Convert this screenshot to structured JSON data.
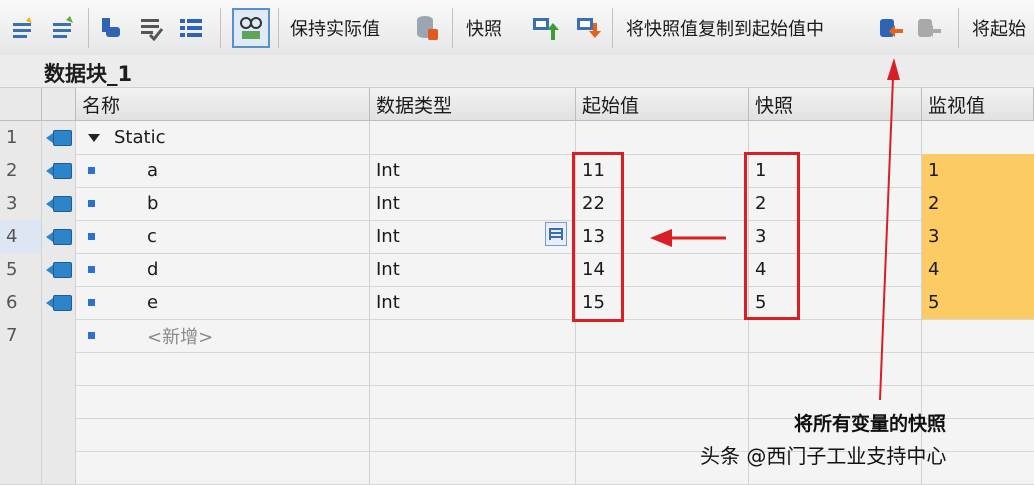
{
  "toolbar": {
    "keep_actual": "保持实际值",
    "snapshot": "快照",
    "copy_snapshot": "将快照值复制到起始值中",
    "load_start": "将起始"
  },
  "block": {
    "title": "数据块_1"
  },
  "columns": {
    "name": "名称",
    "type": "数据类型",
    "start": "起始值",
    "snapshot": "快照",
    "monitor": "监视值"
  },
  "rows": [
    {
      "num": "1",
      "name": "Static",
      "type": "",
      "start": "",
      "snapshot": "",
      "monitor": ""
    },
    {
      "num": "2",
      "name": "a",
      "type": "Int",
      "start": "11",
      "snapshot": "1",
      "monitor": "1"
    },
    {
      "num": "3",
      "name": "b",
      "type": "Int",
      "start": "22",
      "snapshot": "2",
      "monitor": "2"
    },
    {
      "num": "4",
      "name": "c",
      "type": "Int",
      "start": "13",
      "snapshot": "3",
      "monitor": "3"
    },
    {
      "num": "5",
      "name": "d",
      "type": "Int",
      "start": "14",
      "snapshot": "4",
      "monitor": "4"
    },
    {
      "num": "6",
      "name": "e",
      "type": "Int",
      "start": "15",
      "snapshot": "5",
      "monitor": "5"
    },
    {
      "num": "7",
      "name": "<新增>"
    }
  ],
  "annotation": "将所有变量的快照",
  "watermark": "头条 @西门子工业支持中心",
  "colors": {
    "monitor_fill": "#fccb63",
    "highlight": "#d91f26",
    "tag_icon": "#2d84c9"
  },
  "icons": [
    "insert-row-icon",
    "add-row-icon",
    "expand-icon",
    "check-block-icon",
    "list-icon",
    "monitor-glasses-icon",
    "db-icon",
    "snapshot-upload-icon",
    "snapshot-download-icon",
    "copy-to-start-icon",
    "load-start-icon"
  ]
}
